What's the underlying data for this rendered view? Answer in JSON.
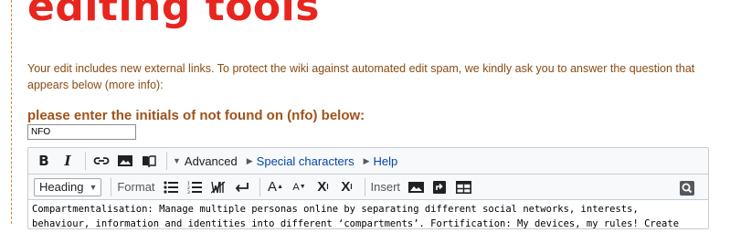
{
  "page": {
    "heading": "editing tools",
    "notice": "Your edit includes new external links. To protect the wiki against automated edit spam, we kindly ask you to answer the question that appears below (more info):"
  },
  "captcha": {
    "label": "please enter the initials of not found on (nfo) below:",
    "value": "NFO"
  },
  "toolbar": {
    "bold": "B",
    "italic": "I",
    "advanced": "Advanced",
    "special_characters": "Special characters",
    "help": "Help",
    "heading_select": "Heading",
    "format_label": "Format",
    "insert_label": "Insert",
    "big": "A",
    "small": "A",
    "superscript": "X",
    "subscript": "X"
  },
  "editor": {
    "lines": [
      "Compartmentalisation: Manage multiple personas online by separating different social networks, interests,",
      "behaviour, information and identities into different ‘compartments’. Fortification: My devices, my rules! Create"
    ]
  },
  "colors": {
    "heading": "#e8251f",
    "notice_text": "#8a4b12",
    "link": "#0645ad"
  }
}
